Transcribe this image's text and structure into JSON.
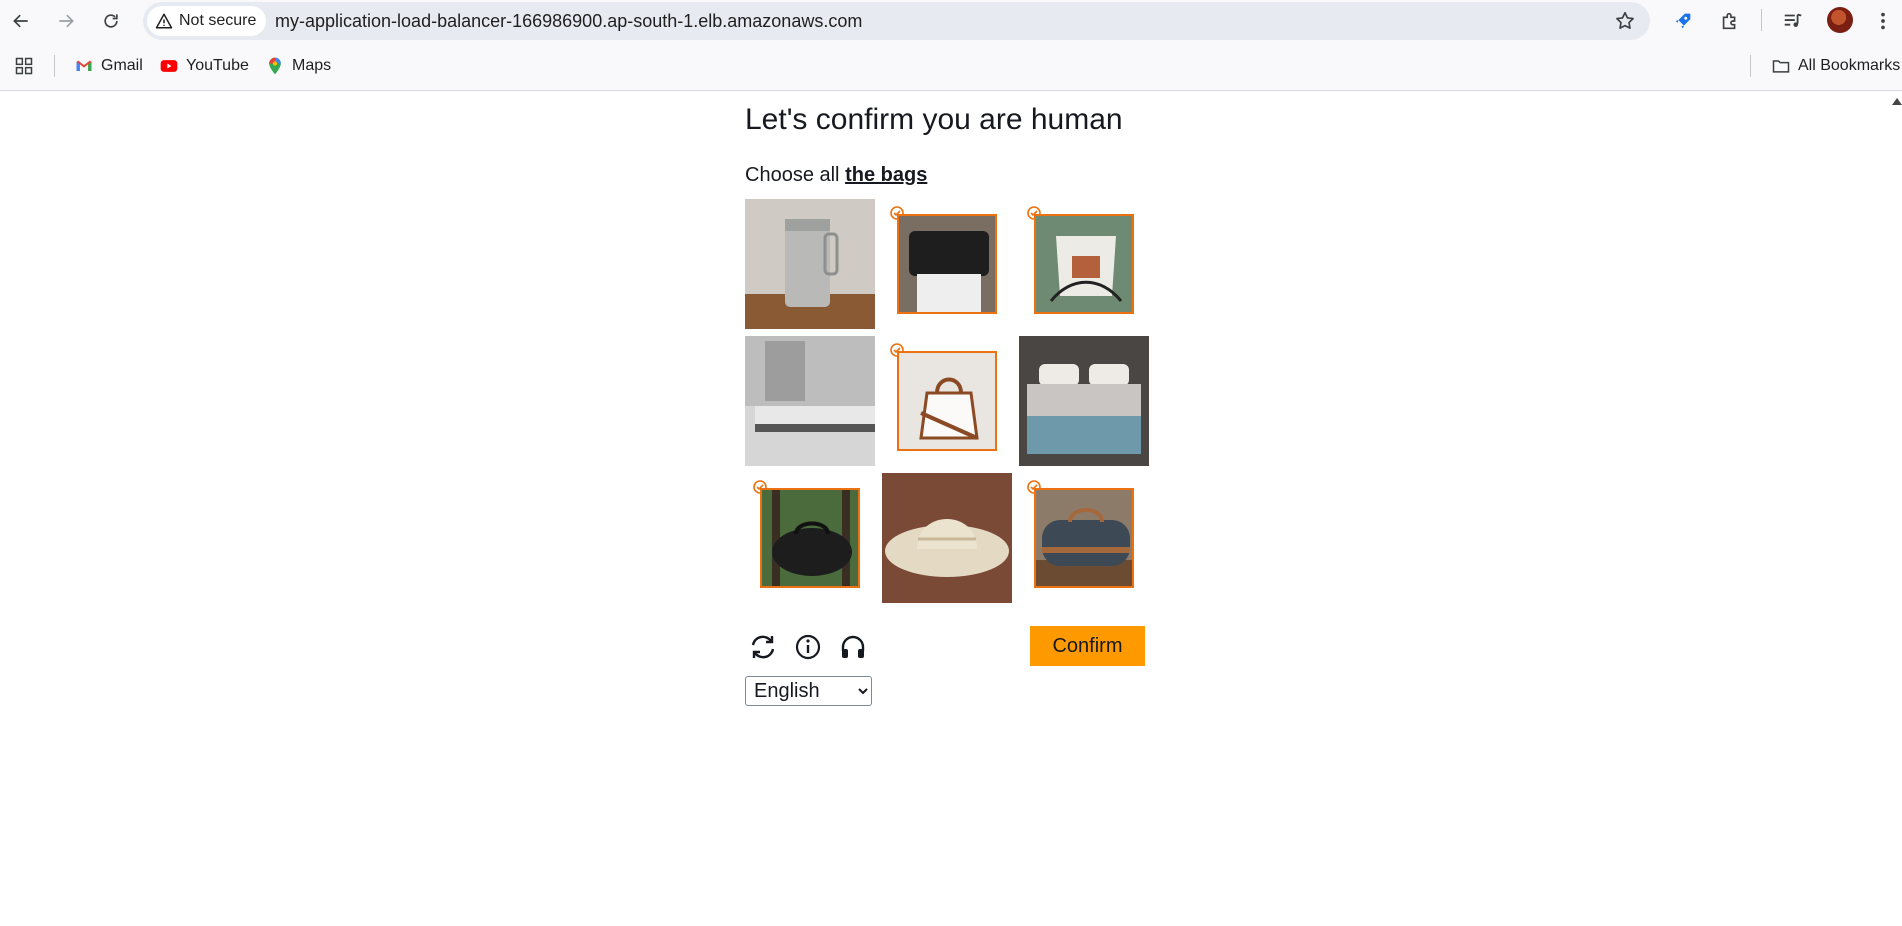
{
  "browser": {
    "security_label": "Not secure",
    "url": "my-application-load-balancer-166986900.ap-south-1.elb.amazonaws.com"
  },
  "bookmarks": {
    "items": [
      {
        "label": "Gmail",
        "icon": "gmail-icon"
      },
      {
        "label": "YouTube",
        "icon": "youtube-icon"
      },
      {
        "label": "Maps",
        "icon": "maps-icon"
      }
    ],
    "all_bookmarks_label": "All Bookmarks"
  },
  "captcha": {
    "title": "Let's confirm you are human",
    "prompt_prefix": "Choose all",
    "prompt_target": "the bags",
    "tiles": [
      {
        "subject": "metal canister",
        "selected": false
      },
      {
        "subject": "black bag",
        "selected": true
      },
      {
        "subject": "white drawstring bag",
        "selected": true
      },
      {
        "subject": "bed",
        "selected": false
      },
      {
        "subject": "tote bag",
        "selected": true
      },
      {
        "subject": "bed with pillows",
        "selected": false
      },
      {
        "subject": "black duffel bag",
        "selected": true
      },
      {
        "subject": "straw hat",
        "selected": false
      },
      {
        "subject": "grey duffel bag",
        "selected": true
      }
    ],
    "confirm_label": "Confirm",
    "language": {
      "selected": "English",
      "options": [
        "English"
      ]
    },
    "icons": [
      "refresh-icon",
      "info-icon",
      "audio-icon"
    ],
    "accent_color": "#ff9900",
    "selection_color": "#ec7211"
  }
}
